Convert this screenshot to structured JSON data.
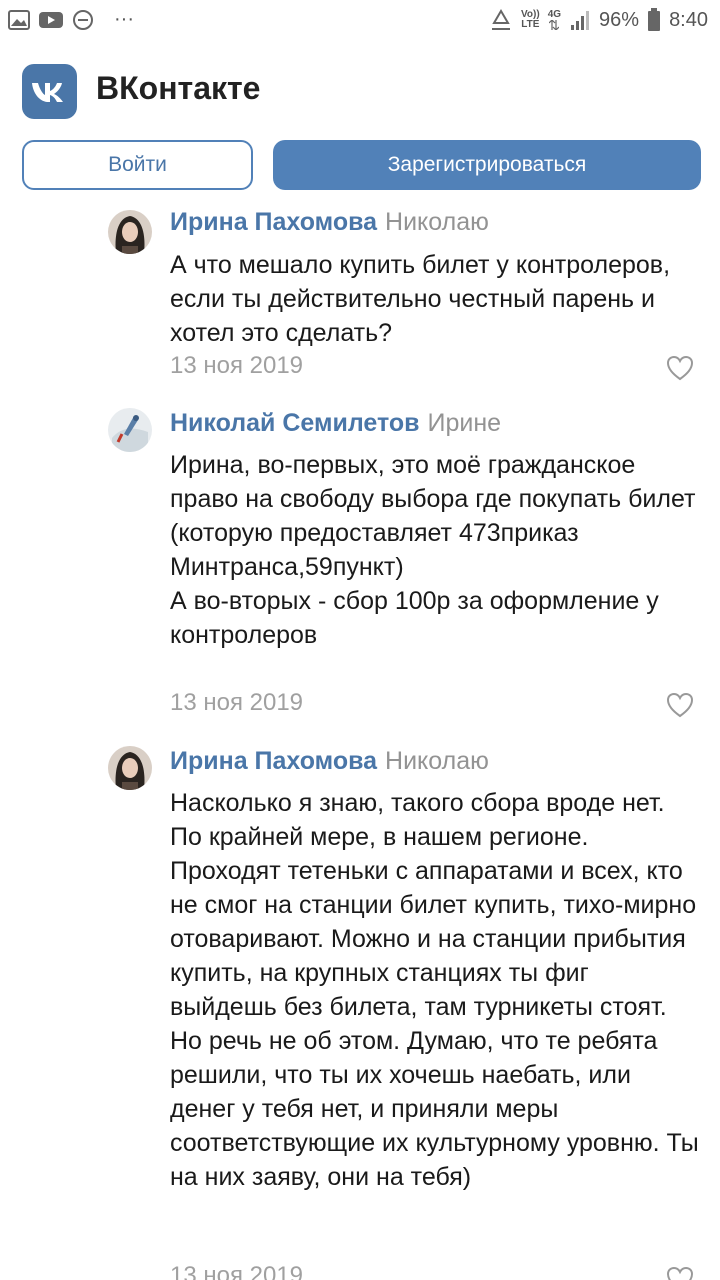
{
  "status_bar": {
    "volte": "Vo))",
    "lte": "LTE",
    "network": "4G",
    "battery": "96%",
    "time": "8:40",
    "dots": "···"
  },
  "header": {
    "title": "ВКонтакте",
    "logo_text": "VK"
  },
  "buttons": {
    "login": "Войти",
    "register": "Зарегистрироваться"
  },
  "colors": {
    "accent": "#4a76a8",
    "button": "#5181b8",
    "muted": "#939393"
  },
  "comments": [
    {
      "author": "Ирина Пахомова",
      "reply_to": "Николаю",
      "lines": [
        "А что мешало купить билет у контролеров, если ты действительно честный парень и хотел это сделать?"
      ],
      "date": "13 ноя 2019"
    },
    {
      "author": "Николай Семилетов",
      "reply_to": "Ирине",
      "lines": [
        "Ирина, во-первых, это моё гражданское право на свободу выбора где покупать билет (которую предоставляет 473приказ Минтранса,59пункт)",
        "А во-вторых - сбор 100р за оформление у контролеров"
      ],
      "date": "13 ноя 2019"
    },
    {
      "author": "Ирина Пахомова",
      "reply_to": "Николаю",
      "lines": [
        "Насколько я знаю, такого сбора вроде нет. По крайней мере, в нашем регионе. Проходят тетеньки с аппаратами и всех, кто не смог на станции билет купить, тихо-мирно отоваривают. Можно и на станции прибытия купить, на крупных станциях ты фиг выйдешь без билета, там турникеты стоят. Но речь не об этом. Думаю, что те ребята решили, что ты их хочешь наебать, или денег у тебя нет, и приняли меры соответствующие их культурному уровню. Ты на них заяву, они на тебя)"
      ],
      "date": "13 ноя 2019"
    }
  ]
}
